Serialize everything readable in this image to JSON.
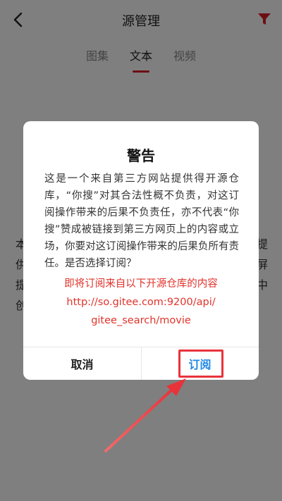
{
  "header": {
    "title": "源管理",
    "back_icon": "chevron-left-icon",
    "filter_icon": "funnel-filter-icon",
    "filter_color": "#d81e2b"
  },
  "tabs": [
    {
      "label": "图集",
      "active": false
    },
    {
      "label": "文本",
      "active": true
    },
    {
      "label": "视频",
      "active": false
    }
  ],
  "background_text": {
    "lines": [
      "本",
      "供",
      "提",
      "创"
    ],
    "right_chars": [
      "提",
      "屏",
      "中"
    ]
  },
  "dialog": {
    "title": "警告",
    "message": "这是一个来自第三方网站提供得开源仓库，“你搜”对其合法性概不负责，对这订阅操作带来的后果不负责任，亦不代表“你搜”赞成被链接到第三方网页上的内容或立场，你要对这订阅操作带来的后果负所有责任。是否选择订阅？",
    "red_line1": "即将订阅来自以下开源仓库的内容",
    "red_line2": "http://so.gitee.com:9200/api/",
    "red_line3": "gitee_search/movie",
    "cancel_label": "取消",
    "subscribe_label": "订阅",
    "subscribe_color": "#1e88e5",
    "red_color": "#e0332b"
  },
  "annotation": {
    "highlight_color": "#e8333b"
  }
}
